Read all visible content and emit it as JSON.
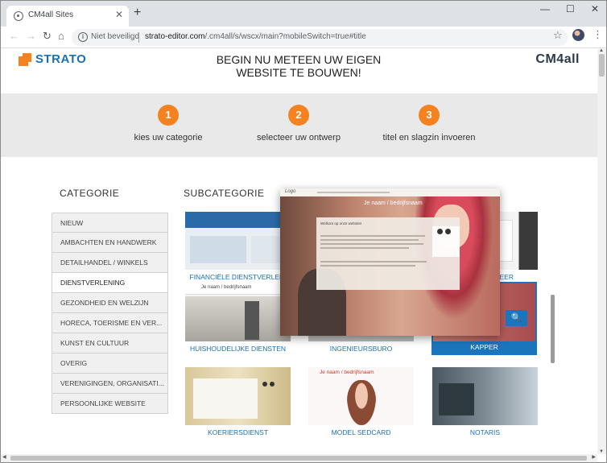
{
  "browser": {
    "tab_title": "CM4all Sites",
    "close_glyph": "✕",
    "newtab_glyph": "+",
    "minimize_glyph": "—",
    "maximize_glyph": "☐",
    "closewin_glyph": "✕",
    "back_glyph": "←",
    "forward_glyph": "→",
    "reload_glyph": "↻",
    "home_glyph": "⌂",
    "info_glyph": "i",
    "insecure_label": "Niet beveiligd",
    "url_host": "strato-editor.com",
    "url_path": "/.cm4all/s/wscx/main?mobileSwitch=true#title",
    "star_glyph": "☆",
    "menu_glyph": "⋮"
  },
  "header": {
    "brand_left": "STRATO",
    "headline_line1": "BEGIN NU METEEN UW EIGEN",
    "headline_line2": "WEBSITE TE BOUWEN!",
    "brand_right": "CM4all"
  },
  "steps": [
    {
      "num": "1",
      "label": "kies uw categorie"
    },
    {
      "num": "2",
      "label": "selecteer uw ontwerp"
    },
    {
      "num": "3",
      "label": "titel en slagzin invoeren"
    }
  ],
  "categories_title": "CATEGORIE",
  "subcategories_title": "SUBCATEGORIE",
  "categories": [
    "NIEUW",
    "AMBACHTEN EN HANDWERK",
    "DETAILHANDEL / WINKELS",
    "DIENSTVERLENING",
    "GEZONDHEID EN WELZIJN",
    "HORECA, TOERISME EN VER...",
    "KUNST EN CULTUUR",
    "OVERIG",
    "VERENIGINGEN, ORGANISATI...",
    "PERSOONLIJKE WEBSITE"
  ],
  "active_category_index": 3,
  "subcategories": [
    {
      "label": "FINANCIËLE DIENSTVERLENI"
    },
    {
      "label": "EER"
    },
    {
      "label": "HUISHOUDELIJKE DIENSTEN"
    },
    {
      "label": "INGENIEURSBURO"
    },
    {
      "label": "KAPPER"
    },
    {
      "label": "KOERIERSDIENST"
    },
    {
      "label": "MODEL SEDCARD"
    },
    {
      "label": "NOTARIS"
    }
  ],
  "preview": {
    "logo": "Logo",
    "slogan": "Je naam / bedrijfsnaam",
    "content_heading": "Welkom op onze website!"
  },
  "thumb_texts": {
    "huis": "Je naam / bedrijfsnaam",
    "model": "Je naam / bedrijfsnaam"
  },
  "search_glyph": "🔍",
  "colors": {
    "accent_orange": "#f58220",
    "link_blue": "#1a6fb5",
    "selected_blue": "#1b75bc"
  }
}
